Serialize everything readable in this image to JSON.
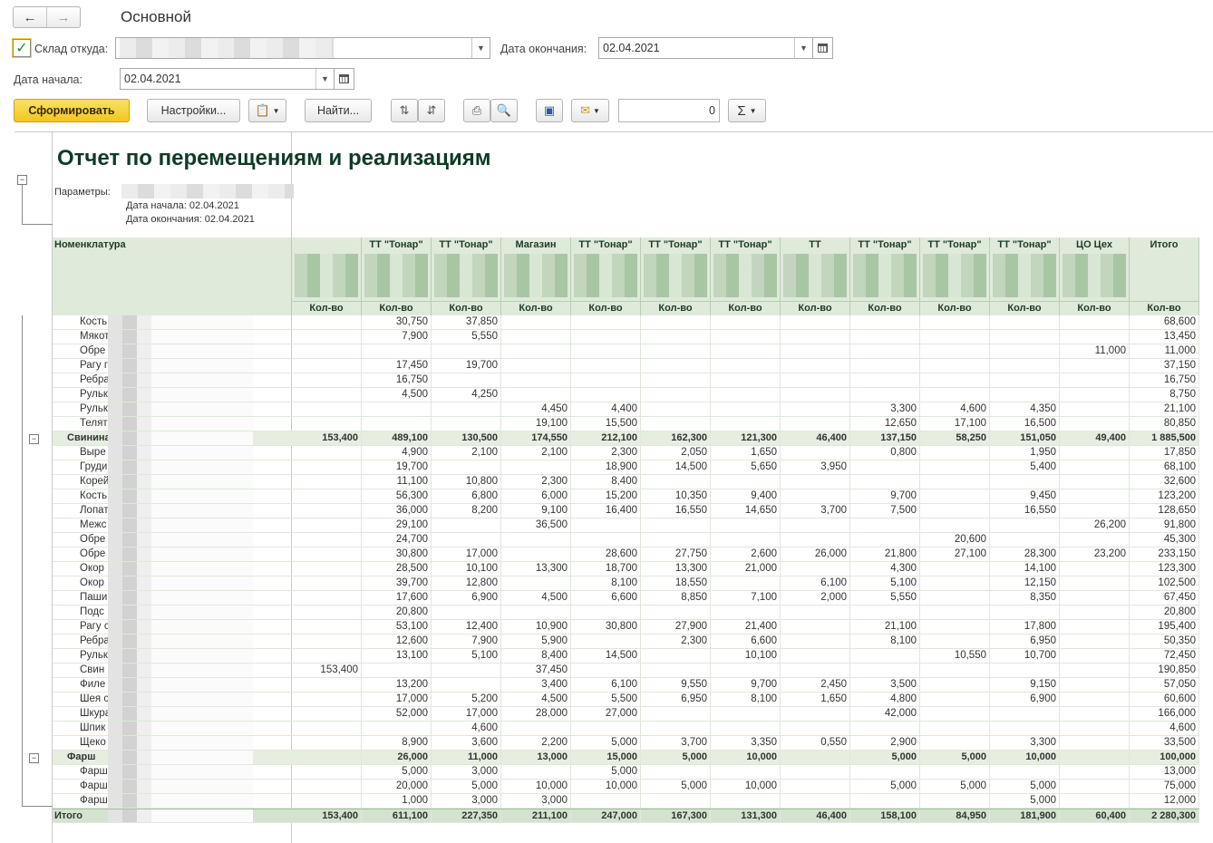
{
  "window": {
    "title": "Основной"
  },
  "filters": {
    "warehouse_label": "Склад откуда:",
    "end_date_label": "Дата окончания:",
    "end_date": "02.04.2021",
    "start_date_label": "Дата начала:",
    "start_date": "02.04.2021"
  },
  "toolbar": {
    "generate_label": "Сформировать",
    "settings_label": "Настройки...",
    "find_label": "Найти...",
    "counter_value": "0",
    "sum_icon": "Σ"
  },
  "report": {
    "title": "Отчет по перемещениям и реализациям",
    "params_label": "Параметры:",
    "start_line": "Дата начала: 02.04.2021",
    "end_line": "Дата окончания: 02.04.2021",
    "col_nom": "Номенклатура",
    "qty_label": "Кол-во",
    "columns": [
      "",
      "ТТ \"Тонар\"",
      "ТТ \"Тонар\"",
      "Магазин",
      "ТТ \"Тонар\"",
      "ТТ \"Тонар\"",
      "ТТ \"Тонар\"",
      "ТТ",
      "ТТ \"Тонар\"",
      "ТТ \"Тонар\"",
      "ТТ \"Тонар\"",
      "ЦО Цех",
      "Итого"
    ],
    "rows": [
      {
        "name": "Кость",
        "type": "item",
        "v": [
          "",
          "30,750",
          "37,850",
          "",
          "",
          "",
          "",
          "",
          "",
          "",
          "",
          "",
          "68,600"
        ]
      },
      {
        "name": "Мякот",
        "type": "item",
        "v": [
          "",
          "7,900",
          "5,550",
          "",
          "",
          "",
          "",
          "",
          "",
          "",
          "",
          "",
          "13,450"
        ]
      },
      {
        "name": "Обре",
        "type": "item",
        "v": [
          "",
          "",
          "",
          "",
          "",
          "",
          "",
          "",
          "",
          "",
          "",
          "11,000",
          "11,000"
        ]
      },
      {
        "name": "Рагу г",
        "type": "item",
        "v": [
          "",
          "17,450",
          "19,700",
          "",
          "",
          "",
          "",
          "",
          "",
          "",
          "",
          "",
          "37,150"
        ]
      },
      {
        "name": "Ребра",
        "type": "item",
        "v": [
          "",
          "16,750",
          "",
          "",
          "",
          "",
          "",
          "",
          "",
          "",
          "",
          "",
          "16,750"
        ]
      },
      {
        "name": "Рульк",
        "type": "item",
        "v": [
          "",
          "4,500",
          "4,250",
          "",
          "",
          "",
          "",
          "",
          "",
          "",
          "",
          "",
          "8,750"
        ]
      },
      {
        "name": "Рульк",
        "type": "item",
        "v": [
          "",
          "",
          "",
          "4,450",
          "4,400",
          "",
          "",
          "",
          "3,300",
          "4,600",
          "4,350",
          "",
          "21,100"
        ]
      },
      {
        "name": "Телят",
        "type": "item",
        "v": [
          "",
          "",
          "",
          "19,100",
          "15,500",
          "",
          "",
          "",
          "12,650",
          "17,100",
          "16,500",
          "",
          "80,850"
        ]
      },
      {
        "name": "Свинина",
        "type": "group",
        "v": [
          "153,400",
          "489,100",
          "130,500",
          "174,550",
          "212,100",
          "162,300",
          "121,300",
          "46,400",
          "137,150",
          "58,250",
          "151,050",
          "49,400",
          "1 885,500"
        ]
      },
      {
        "name": "Выре",
        "type": "item",
        "v": [
          "",
          "4,900",
          "2,100",
          "2,100",
          "2,300",
          "2,050",
          "1,650",
          "",
          "0,800",
          "",
          "1,950",
          "",
          "17,850"
        ]
      },
      {
        "name": "Груди",
        "type": "item",
        "v": [
          "",
          "19,700",
          "",
          "",
          "18,900",
          "14,500",
          "5,650",
          "3,950",
          "",
          "",
          "5,400",
          "",
          "68,100"
        ]
      },
      {
        "name": "Корей",
        "type": "item",
        "v": [
          "",
          "11,100",
          "10,800",
          "2,300",
          "8,400",
          "",
          "",
          "",
          "",
          "",
          "",
          "",
          "32,600"
        ]
      },
      {
        "name": "Кость",
        "type": "item",
        "v": [
          "",
          "56,300",
          "6,800",
          "6,000",
          "15,200",
          "10,350",
          "9,400",
          "",
          "9,700",
          "",
          "9,450",
          "",
          "123,200"
        ]
      },
      {
        "name": "Лопат",
        "type": "item",
        "v": [
          "",
          "36,000",
          "8,200",
          "9,100",
          "16,400",
          "16,550",
          "14,650",
          "3,700",
          "7,500",
          "",
          "16,550",
          "",
          "128,650"
        ]
      },
      {
        "name": "Межс",
        "type": "item",
        "v": [
          "",
          "29,100",
          "",
          "36,500",
          "",
          "",
          "",
          "",
          "",
          "",
          "",
          "26,200",
          "91,800"
        ]
      },
      {
        "name": "Обре",
        "type": "item",
        "v": [
          "",
          "24,700",
          "",
          "",
          "",
          "",
          "",
          "",
          "",
          "20,600",
          "",
          "",
          "45,300"
        ]
      },
      {
        "name": "Обре",
        "type": "item",
        "v": [
          "",
          "30,800",
          "17,000",
          "",
          "28,600",
          "27,750",
          "2,600",
          "26,000",
          "21,800",
          "27,100",
          "28,300",
          "23,200",
          "233,150"
        ]
      },
      {
        "name": "Окор",
        "type": "item",
        "v": [
          "",
          "28,500",
          "10,100",
          "13,300",
          "18,700",
          "13,300",
          "21,000",
          "",
          "4,300",
          "",
          "14,100",
          "",
          "123,300"
        ]
      },
      {
        "name": "Окор",
        "type": "item",
        "v": [
          "",
          "39,700",
          "12,800",
          "",
          "8,100",
          "18,550",
          "",
          "6,100",
          "5,100",
          "",
          "12,150",
          "",
          "102,500"
        ]
      },
      {
        "name": "Паши",
        "type": "item",
        "v": [
          "",
          "17,600",
          "6,900",
          "4,500",
          "6,600",
          "8,850",
          "7,100",
          "2,000",
          "5,550",
          "",
          "8,350",
          "",
          "67,450"
        ]
      },
      {
        "name": "Подс",
        "type": "item",
        "v": [
          "",
          "20,800",
          "",
          "",
          "",
          "",
          "",
          "",
          "",
          "",
          "",
          "",
          "20,800"
        ]
      },
      {
        "name": "Рагу с",
        "type": "item",
        "v": [
          "",
          "53,100",
          "12,400",
          "10,900",
          "30,800",
          "27,900",
          "21,400",
          "",
          "21,100",
          "",
          "17,800",
          "",
          "195,400"
        ]
      },
      {
        "name": "Ребра",
        "type": "item",
        "v": [
          "",
          "12,600",
          "7,900",
          "5,900",
          "",
          "2,300",
          "6,600",
          "",
          "8,100",
          "",
          "6,950",
          "",
          "50,350"
        ]
      },
      {
        "name": "Рульк",
        "type": "item",
        "v": [
          "",
          "13,100",
          "5,100",
          "8,400",
          "14,500",
          "",
          "10,100",
          "",
          "",
          "10,550",
          "10,700",
          "",
          "72,450"
        ]
      },
      {
        "name": "Свин",
        "type": "item",
        "v": [
          "153,400",
          "",
          "",
          "37,450",
          "",
          "",
          "",
          "",
          "",
          "",
          "",
          "",
          "190,850"
        ]
      },
      {
        "name": "Филе",
        "type": "item",
        "v": [
          "",
          "13,200",
          "",
          "3,400",
          "6,100",
          "9,550",
          "9,700",
          "2,450",
          "3,500",
          "",
          "9,150",
          "",
          "57,050"
        ]
      },
      {
        "name": "Шея с",
        "type": "item",
        "v": [
          "",
          "17,000",
          "5,200",
          "4,500",
          "5,500",
          "6,950",
          "8,100",
          "1,650",
          "4,800",
          "",
          "6,900",
          "",
          "60,600"
        ]
      },
      {
        "name": "Шкура",
        "type": "item",
        "v": [
          "",
          "52,000",
          "17,000",
          "28,000",
          "27,000",
          "",
          "",
          "",
          "42,000",
          "",
          "",
          "",
          "166,000"
        ]
      },
      {
        "name": "Шпик",
        "type": "item",
        "v": [
          "",
          "",
          "4,600",
          "",
          "",
          "",
          "",
          "",
          "",
          "",
          "",
          "",
          "4,600"
        ]
      },
      {
        "name": "Щеко",
        "type": "item",
        "v": [
          "",
          "8,900",
          "3,600",
          "2,200",
          "5,000",
          "3,700",
          "3,350",
          "0,550",
          "2,900",
          "",
          "3,300",
          "",
          "33,500"
        ]
      },
      {
        "name": "Фарш",
        "type": "group",
        "v": [
          "",
          "26,000",
          "11,000",
          "13,000",
          "15,000",
          "5,000",
          "10,000",
          "",
          "5,000",
          "5,000",
          "10,000",
          "",
          "100,000"
        ]
      },
      {
        "name": "Фарш",
        "type": "item",
        "v": [
          "",
          "5,000",
          "3,000",
          "",
          "5,000",
          "",
          "",
          "",
          "",
          "",
          "",
          "",
          "13,000"
        ]
      },
      {
        "name": "Фарш",
        "type": "item",
        "v": [
          "",
          "20,000",
          "5,000",
          "10,000",
          "10,000",
          "5,000",
          "10,000",
          "",
          "5,000",
          "5,000",
          "5,000",
          "",
          "75,000"
        ]
      },
      {
        "name": "Фарш",
        "type": "item",
        "v": [
          "",
          "1,000",
          "3,000",
          "3,000",
          "",
          "",
          "",
          "",
          "",
          "",
          "5,000",
          "",
          "12,000"
        ]
      },
      {
        "name": "Итого",
        "type": "total",
        "v": [
          "153,400",
          "611,100",
          "227,350",
          "211,100",
          "247,000",
          "167,300",
          "131,300",
          "46,400",
          "158,100",
          "84,950",
          "181,900",
          "60,400",
          "2 280,300"
        ]
      }
    ]
  }
}
